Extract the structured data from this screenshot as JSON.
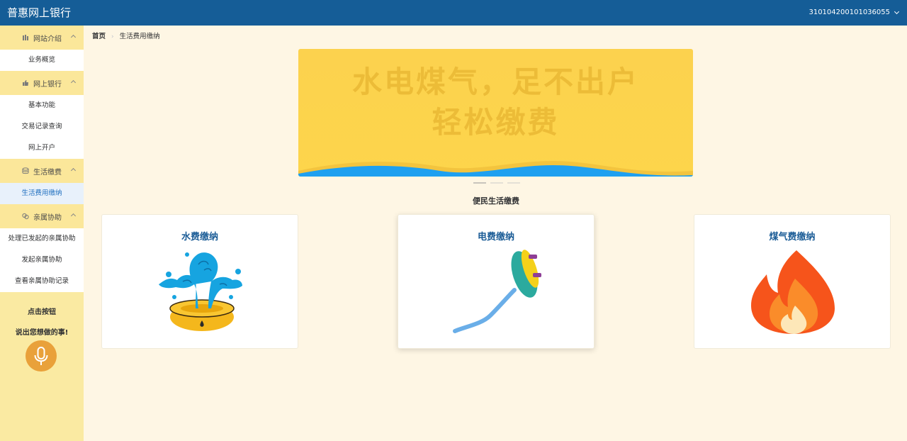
{
  "header": {
    "brand": "普惠网上银行",
    "account": "310104200101036055"
  },
  "sidebar": {
    "groups": [
      {
        "label": "网站介绍",
        "icon": "library-icon",
        "items": [
          "业务概览"
        ]
      },
      {
        "label": "网上银行",
        "icon": "thumbs-up-icon",
        "items": [
          "基本功能",
          "交易记录查询",
          "网上开户"
        ]
      },
      {
        "label": "生活缴费",
        "icon": "database-icon",
        "items": [
          "生活费用缴纳"
        ]
      },
      {
        "label": "亲属协助",
        "icon": "link-icon",
        "items": [
          "处理已发起的亲属协助",
          "发起亲属协助",
          "查看亲属协助记录"
        ]
      }
    ],
    "active_item": "生活费用缴纳",
    "voice": {
      "line1": "点击按钮",
      "line2": "说出您想做的事!"
    }
  },
  "breadcrumb": {
    "home": "首页",
    "current": "生活费用缴纳"
  },
  "banner": {
    "line1": "水电煤气，足不出户",
    "line2": "轻松缴费",
    "slide_count": 3,
    "active_slide": 1
  },
  "section_title": "便民生活缴费",
  "cards": [
    {
      "title": "水费缴纳",
      "icon": "water-fountain-icon"
    },
    {
      "title": "电费缴纳",
      "icon": "electric-plug-icon"
    },
    {
      "title": "煤气费缴纳",
      "icon": "gas-flame-icon"
    }
  ],
  "colors": {
    "topbar": "#155d97",
    "sidebar": "#faeaa2",
    "page_bg": "#fef6e4",
    "card_title": "#1c5d97",
    "mic": "#e9a13a"
  }
}
